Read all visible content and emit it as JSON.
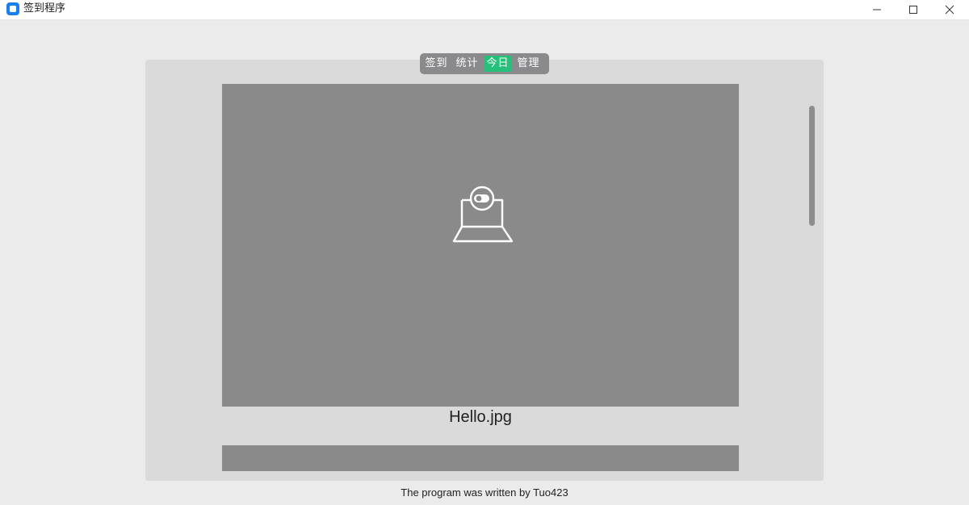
{
  "window": {
    "title": "签到程序",
    "icon": "app-icon",
    "controls": [
      "minimize-icon",
      "maximize-icon",
      "close-icon"
    ]
  },
  "tabs": [
    {
      "label": "签到",
      "active": false
    },
    {
      "label": "统计",
      "active": false
    },
    {
      "label": "今日",
      "active": true
    },
    {
      "label": "管理",
      "active": false
    }
  ],
  "colors": {
    "active_tab": "#26c07a",
    "tab_bar": "#8a8a8d",
    "image_placeholder": "#8a8a8b",
    "panel": "#dadada"
  },
  "gallery": {
    "items": [
      {
        "icon": "webcam-icon",
        "filename": "Hello.jpg"
      }
    ]
  },
  "footer": {
    "text": "The program was written by Tuo423"
  }
}
